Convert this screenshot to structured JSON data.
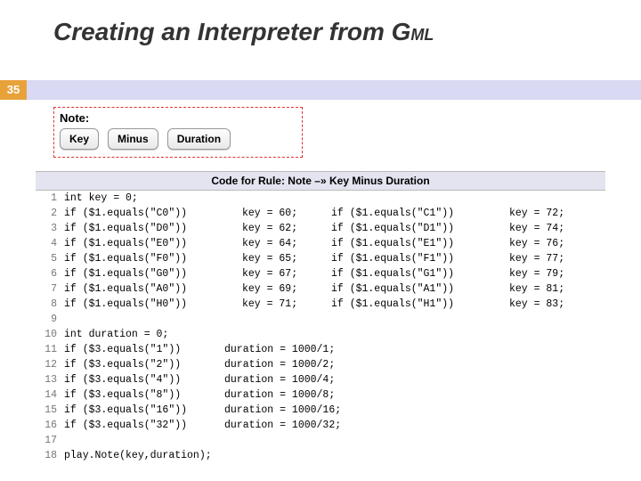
{
  "title_main": "Creating an Interpreter from G",
  "title_sub": "ML",
  "page_number": "35",
  "note_label": "Note:",
  "tokens": [
    "Key",
    "Minus",
    "Duration"
  ],
  "rule_header": "Code for Rule: Note –» Key Minus Duration",
  "code": {
    "lines": [
      {
        "n": "1",
        "c1": "int key = 0;",
        "c2": "",
        "c3": "",
        "c4": ""
      },
      {
        "n": "2",
        "c1": "if ($1.equals(\"C0\"))",
        "c2": "key = 60;",
        "c3": "if ($1.equals(\"C1\"))",
        "c4": "key = 72;"
      },
      {
        "n": "3",
        "c1": "if ($1.equals(\"D0\"))",
        "c2": "key = 62;",
        "c3": "if ($1.equals(\"D1\"))",
        "c4": "key = 74;"
      },
      {
        "n": "4",
        "c1": "if ($1.equals(\"E0\"))",
        "c2": "key = 64;",
        "c3": "if ($1.equals(\"E1\"))",
        "c4": "key = 76;"
      },
      {
        "n": "5",
        "c1": "if ($1.equals(\"F0\"))",
        "c2": "key = 65;",
        "c3": "if ($1.equals(\"F1\"))",
        "c4": "key = 77;"
      },
      {
        "n": "6",
        "c1": "if ($1.equals(\"G0\"))",
        "c2": "key = 67;",
        "c3": "if ($1.equals(\"G1\"))",
        "c4": "key = 79;"
      },
      {
        "n": "7",
        "c1": "if ($1.equals(\"A0\"))",
        "c2": "key = 69;",
        "c3": "if ($1.equals(\"A1\"))",
        "c4": "key = 81;"
      },
      {
        "n": "8",
        "c1": "if ($1.equals(\"H0\"))",
        "c2": "key = 71;",
        "c3": "if ($1.equals(\"H1\"))",
        "c4": "key = 83;"
      },
      {
        "n": "9",
        "c1": "",
        "c2": "",
        "c3": "",
        "c4": ""
      },
      {
        "n": "10",
        "c1": "int duration = 0;",
        "c2": "",
        "c3": "",
        "c4": ""
      },
      {
        "n": "11",
        "c1": "if ($3.equals(\"1\"))",
        "c2": "duration = 1000/1;",
        "c3": "",
        "c4": ""
      },
      {
        "n": "12",
        "c1": "if ($3.equals(\"2\"))",
        "c2": "duration = 1000/2;",
        "c3": "",
        "c4": ""
      },
      {
        "n": "13",
        "c1": "if ($3.equals(\"4\"))",
        "c2": "duration = 1000/4;",
        "c3": "",
        "c4": ""
      },
      {
        "n": "14",
        "c1": "if ($3.equals(\"8\"))",
        "c2": "duration = 1000/8;",
        "c3": "",
        "c4": ""
      },
      {
        "n": "15",
        "c1": "if ($3.equals(\"16\"))",
        "c2": "duration = 1000/16;",
        "c3": "",
        "c4": ""
      },
      {
        "n": "16",
        "c1": "if ($3.equals(\"32\"))",
        "c2": "duration = 1000/32;",
        "c3": "",
        "c4": ""
      },
      {
        "n": "17",
        "c1": "",
        "c2": "",
        "c3": "",
        "c4": ""
      },
      {
        "n": "18",
        "c1": "play.Note(key,duration);",
        "c2": "",
        "c3": "",
        "c4": ""
      }
    ]
  }
}
